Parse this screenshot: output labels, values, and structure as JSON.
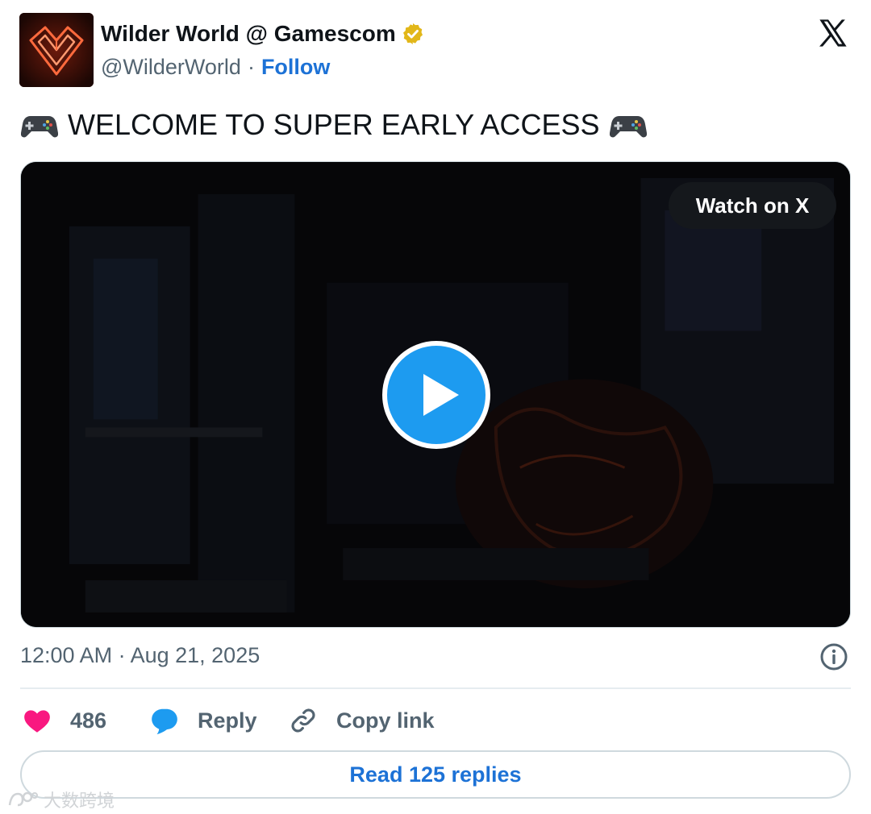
{
  "author": {
    "display_name": "Wilder World @ Gamescom",
    "handle": "@WilderWorld",
    "separator": "·",
    "follow_label": "Follow",
    "avatar_icon": "wilder-world-logo",
    "verified_icon": "gold-verified-badge"
  },
  "tweet": {
    "text": "WELCOME TO SUPER EARLY ACCESS",
    "emoji_icon": "video-game-controller"
  },
  "media": {
    "watch_label": "Watch on X",
    "play_icon": "play-icon"
  },
  "meta": {
    "timestamp": "12:00 AM · Aug 21, 2025"
  },
  "actions": {
    "like_count": "486",
    "reply_label": "Reply",
    "copy_label": "Copy link"
  },
  "read_replies_label": "Read 125 replies",
  "watermark": "大数跨境",
  "colors": {
    "accent_blue": "#1d9bf0",
    "link_blue": "#1d72d6",
    "like_pink": "#f91880",
    "muted_gray": "#536471",
    "verified_gold": "#e2b719"
  }
}
